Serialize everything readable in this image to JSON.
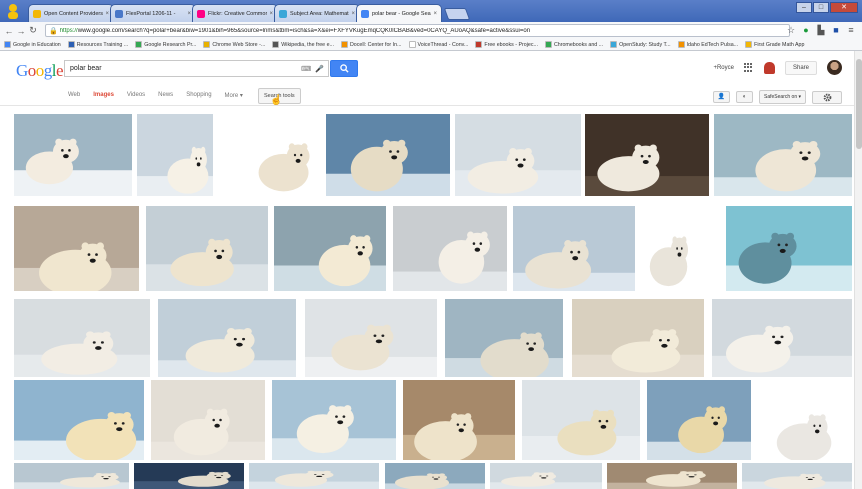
{
  "browser": {
    "tabs": [
      {
        "title": "Open Content Providers",
        "color": "#f2b705"
      },
      {
        "title": "FlexPortal 1206-11 -",
        "color": "#4a78c8"
      },
      {
        "title": "Flickr: Creative Commons",
        "color": "#ff0084"
      },
      {
        "title": "Subject Area: Mathematics",
        "color": "#3aa7d8"
      },
      {
        "title": "polar bear - Google Search",
        "color": "#4285f4",
        "active": true
      }
    ],
    "url_protocol": "https://",
    "url_rest": "www.google.com/search?q=polar+bear&biw=1901&bih=965&source=lnms&tbm=isch&sa=X&ei=FXFYVKugEmqCQK0lCBAB&ved=0CAYQ_AUoAQ&safe=active&ssui=on",
    "bookmarks": [
      {
        "label": "Google in Education",
        "color": "#4285f4"
      },
      {
        "label": "Resources Training ...",
        "color": "#2c5fb3"
      },
      {
        "label": "Google Research Pr...",
        "color": "#34a853"
      },
      {
        "label": "Chrome Web Store -...",
        "color": "#e8b100"
      },
      {
        "label": "Wikipedia, the free e...",
        "color": "#555555"
      },
      {
        "label": "Docell: Center for In...",
        "color": "#f29100"
      },
      {
        "label": "VoiceThread - Conv...",
        "color": "#ffffff"
      },
      {
        "label": "Free ebooks - Projec...",
        "color": "#c0392b"
      },
      {
        "label": "Chromebooks and ...",
        "color": "#34a853"
      },
      {
        "label": "OpenStudy: Study T...",
        "color": "#3aa7d8"
      },
      {
        "label": "Idaho EdTech Pulsa...",
        "color": "#f29100"
      },
      {
        "label": "First Grade Math App",
        "color": "#f2b705"
      }
    ]
  },
  "google": {
    "logo": [
      "G",
      "o",
      "o",
      "g",
      "l",
      "e"
    ],
    "logo_colors": [
      "#4285f4",
      "#db4437",
      "#f4b400",
      "#4285f4",
      "#0f9d58",
      "#db4437"
    ],
    "query": "polar bear",
    "user": "+Royce",
    "share_label": "Share",
    "nav": [
      "Web",
      "Images",
      "Videos",
      "News",
      "Shopping",
      "More ▾"
    ],
    "active_nav": "Images",
    "search_tools_label": "Search tools",
    "safesearch_label": "SafeSearch on ▾"
  },
  "results": {
    "rows": [
      [
        {
          "bg": "#9fb6c4",
          "bear": "#f3ece0",
          "snow": "#eef2f5"
        },
        {
          "bg": "#cbd6df",
          "bear": "#f6f1e6",
          "snow": "#e9eef2"
        },
        {
          "bg": "#ffffff",
          "bear": "#ece2cf",
          "snow": "#ffffff"
        },
        {
          "bg": "#5f86a8",
          "bear": "#e6dcc5",
          "snow": "#cfdde8"
        },
        {
          "bg": "#d5dde3",
          "bear": "#f2ede3",
          "snow": "#e4eaef"
        },
        {
          "bg": "#403228",
          "bear": "#efe9dd",
          "snow": "#5a4a3c"
        },
        {
          "bg": "#9db8c4",
          "bear": "#eee6d6",
          "snow": "#d9e6ec"
        }
      ],
      [
        {
          "bg": "#b7a897",
          "bear": "#f0e6cf",
          "snow": "#d8cfc2"
        },
        {
          "bg": "#c4cfd6",
          "bear": "#eee4ce",
          "snow": "#dbe2e6"
        },
        {
          "bg": "#8da3ae",
          "bear": "#f3ead4",
          "snow": "#cfdde4"
        },
        {
          "bg": "#c9cdd0",
          "bear": "#f4efe6",
          "snow": "#e2e6e9"
        },
        {
          "bg": "#b9c9d6",
          "bear": "#e9e2d3",
          "snow": "#dde6ee"
        },
        {
          "bg": "#ffffff",
          "bear": "#e9e4da",
          "snow": "#ffffff"
        },
        {
          "bg": "#7ec2d2",
          "bear": "#5f8f9e",
          "snow": "#d3eaf0"
        }
      ],
      [
        {
          "bg": "#d8dde0",
          "bear": "#f2ede4",
          "snow": "#e6eaec"
        },
        {
          "bg": "#c1cfd9",
          "bear": "#f0eadb",
          "snow": "#dfe7ed"
        },
        {
          "bg": "#dfe3e6",
          "bear": "#ebe3d2",
          "snow": "#eef0f2"
        },
        {
          "bg": "#9fb5c2",
          "bear": "#e2dccc",
          "snow": "#cfdbe2"
        },
        {
          "bg": "#d9d0bf",
          "bear": "#f2ebd9",
          "snow": "#e5ddd0"
        },
        {
          "bg": "#d2d9de",
          "bear": "#f4f1ea",
          "snow": "#e4e8eb"
        }
      ],
      [
        {
          "bg": "#8fb4cf",
          "bear": "#f2e2b8",
          "snow": "#e3edf3"
        },
        {
          "bg": "#e3ded5",
          "bear": "#f1ebe0",
          "snow": "#ebe6de"
        },
        {
          "bg": "#a7c3d6",
          "bear": "#f5f0e3",
          "snow": "#dbe7ee"
        },
        {
          "bg": "#a6896a",
          "bear": "#eee3ca",
          "snow": "#c9b08e"
        },
        {
          "bg": "#dde3e7",
          "bear": "#eadfbf",
          "snow": "#e9edf0"
        },
        {
          "bg": "#7ea0bb",
          "bear": "#e9d8a8",
          "snow": "#d4e0e8"
        },
        {
          "bg": "#ffffff",
          "bear": "#eae7e2",
          "snow": "#ffffff"
        }
      ],
      [
        {
          "bg": "#b8c7d1",
          "bear": "#efe8da",
          "snow": "#dde5ea"
        },
        {
          "bg": "#253a56",
          "bear": "#e3dccd",
          "snow": "#3f5878"
        },
        {
          "bg": "#c4d3dd",
          "bear": "#eee8db",
          "snow": "#dde6ec"
        },
        {
          "bg": "#8ca9bd",
          "bear": "#e9e1cf",
          "snow": "#c9d8e2"
        },
        {
          "bg": "#d0d9df",
          "bear": "#f0ebe1",
          "snow": "#e2e8ec"
        },
        {
          "bg": "#a08a72",
          "bear": "#eee4cf",
          "snow": "#c3b29e"
        },
        {
          "bg": "#cad6de",
          "bear": "#eee9df",
          "snow": "#e1e8ec"
        }
      ]
    ]
  }
}
